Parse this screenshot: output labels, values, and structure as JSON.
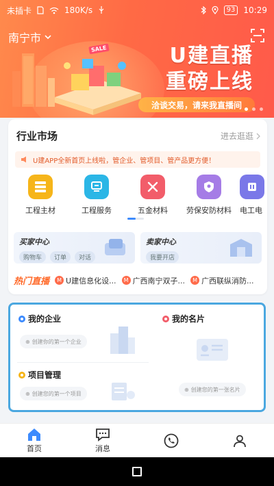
{
  "status": {
    "carrier": "未插卡",
    "speed": "180K/s",
    "battery": "93",
    "time": "10:29"
  },
  "header": {
    "city": "南宁市"
  },
  "banner": {
    "title_line1": "U建直播",
    "title_line2": "重磅上线",
    "pill_text": "洽谈交易，请来我直播间",
    "sale_tag": "SALE"
  },
  "market": {
    "title": "行业市场",
    "more_label": "进去逛逛",
    "notice": "U建APP全新首页上线啦，管企业、管项目、管产品更方便！",
    "categories": [
      {
        "label": "工程主材",
        "color": "#f6b51a"
      },
      {
        "label": "工程服务",
        "color": "#2bb6e6"
      },
      {
        "label": "五金材料",
        "color": "#f25d6a"
      },
      {
        "label": "劳保安防材料",
        "color": "#a57ce6"
      },
      {
        "label": "电工电",
        "color": "#7a78e8"
      }
    ],
    "buyer": {
      "title": "买家中心",
      "chips": [
        "购物车",
        "订单",
        "对话"
      ]
    },
    "seller": {
      "title": "卖家中心",
      "chips": [
        "我要开店"
      ]
    },
    "live": {
      "tag": "热门直播",
      "items": [
        "U建信息化设...",
        "广西南宁双子...",
        "广西联纵消防..."
      ]
    }
  },
  "business": {
    "enterprise": {
      "title": "我的企业",
      "cta": "创建你的第一个企业"
    },
    "card": {
      "title": "我的名片",
      "cta": "创建您的第一张名片"
    },
    "project": {
      "title": "项目管理",
      "cta": "创建您的第一个项目"
    }
  },
  "tabbar": {
    "items": [
      {
        "label": "首页",
        "icon": "home-icon"
      },
      {
        "label": "消息",
        "icon": "message-icon"
      },
      {
        "label": "",
        "icon": "phone-icon"
      },
      {
        "label": "",
        "icon": "profile-icon"
      }
    ]
  },
  "colors": {
    "brand": "#ff6a45",
    "accent": "#3d8bfd",
    "highlight_border": "#4aa7e0"
  }
}
